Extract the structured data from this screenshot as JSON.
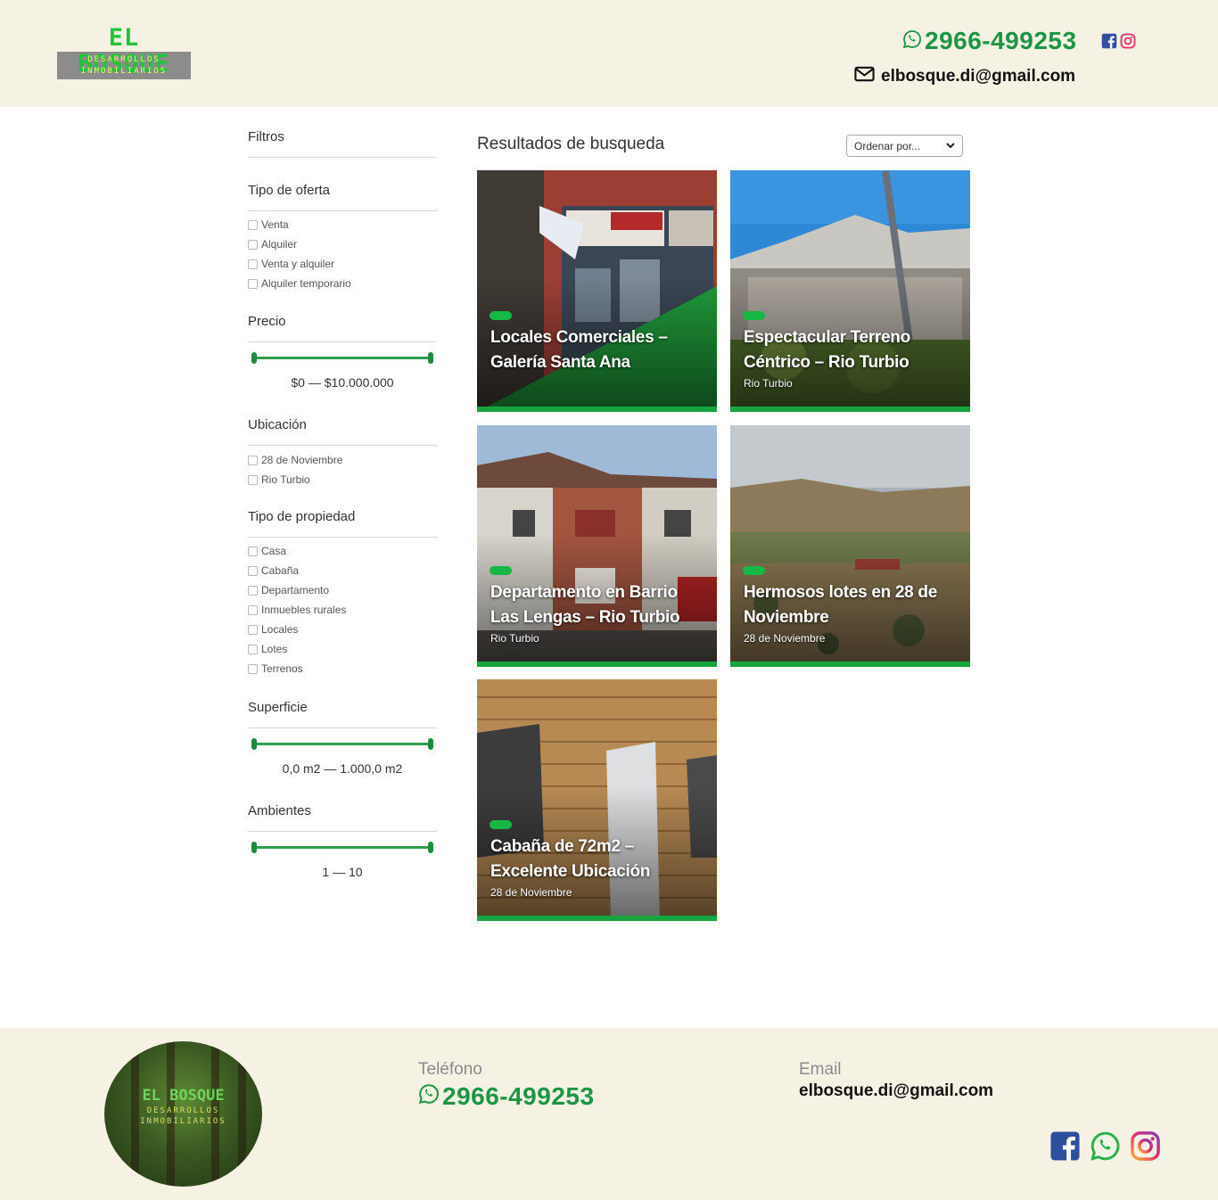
{
  "header": {
    "logo_title": "EL BOSQUE",
    "logo_line1": "DESARROLLOS",
    "logo_line2": "INMOBILIARIOS",
    "phone": "2966-499253",
    "email": "elbosque.di@gmail.com",
    "icons": [
      "whatsapp-icon",
      "facebook-icon",
      "instagram-icon",
      "mail-icon"
    ]
  },
  "sidebar": {
    "filters_title": "Filtros",
    "offer_type": {
      "title": "Tipo de oferta",
      "options": [
        "Venta",
        "Alquiler",
        "Venta y alquiler",
        "Alquiler temporario"
      ]
    },
    "price": {
      "title": "Precio",
      "value": "$0 — $10.000.000",
      "min": 0,
      "max": 1
    },
    "location": {
      "title": "Ubicación",
      "options": [
        "28 de Noviembre",
        "Rio Turbio"
      ]
    },
    "property_type": {
      "title": "Tipo de propiedad",
      "options": [
        "Casa",
        "Cabaña",
        "Departamento",
        "Inmuebles rurales",
        "Locales",
        "Lotes",
        "Terrenos"
      ]
    },
    "surface": {
      "title": "Superficie",
      "value": "0,0 m2 — 1.000,0 m2",
      "min": 0,
      "max": 1
    },
    "rooms": {
      "title": "Ambientes",
      "value": "1 — 10",
      "min": 0,
      "max": 1
    }
  },
  "results": {
    "title": "Resultados de busqueda",
    "sort_label": "Ordenar por...",
    "cards": [
      {
        "title": "Locales Comerciales – Galería Santa Ana",
        "location": ""
      },
      {
        "title": "Espectacular Terreno Céntrico – Rio Turbio",
        "location": "Rio Turbio"
      },
      {
        "title": "Departamento en Barrio Las Lengas – Rio Turbio",
        "location": "Rio Turbio"
      },
      {
        "title": "Hermosos lotes en 28 de Noviembre",
        "location": "28 de Noviembre"
      },
      {
        "title": "Cabaña de 72m2 – Excelente Ubicación",
        "location": "28 de Noviembre"
      }
    ]
  },
  "footer": {
    "logo_title": "EL BOSQUE",
    "logo_line1": "DESARROLLOS",
    "logo_line2": "INMOBILIARIOS",
    "phone_label": "Teléfono",
    "phone": "2966-499253",
    "email_label": "Email",
    "email": "elbosque.di@gmail.com",
    "social_icons": [
      "facebook-icon",
      "whatsapp-icon",
      "instagram-icon"
    ]
  },
  "colors": {
    "brand_green": "#1e9444",
    "header_bg": "#f5f2e4",
    "card_bar": "#16a340",
    "slider": "#2f9e4e"
  }
}
